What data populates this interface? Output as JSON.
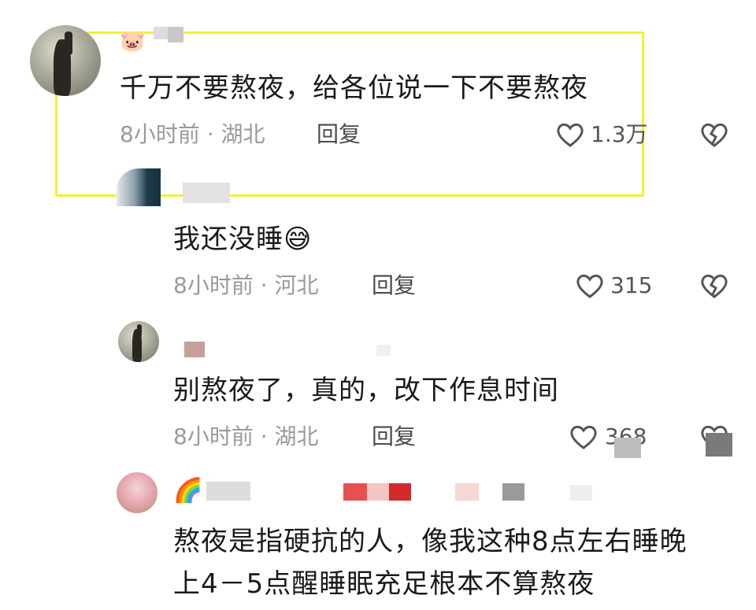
{
  "comments": [
    {
      "text": "千万不要熬夜，给各位说一下不要熬夜",
      "meta": "8小时前 · 湖北",
      "reply": "回复",
      "likes": "1.3万"
    },
    {
      "text": "我还没睡",
      "emoji": "😅",
      "meta": "8小时前 · 河北",
      "reply": "回复",
      "likes": "315"
    },
    {
      "text": "别熬夜了，真的，改下作息时间",
      "meta": "8小时前 · 湖北",
      "reply": "回复",
      "likes": "368"
    },
    {
      "text_line1": "熬夜是指硬抗的人，像我这种8点左右睡晚",
      "text_line2": "上4－5点醒睡眠充足根本不算熬夜",
      "emoji": "🌈"
    }
  ],
  "colors": {
    "highlight": "#f2f230",
    "meta": "#9a9a9a",
    "text": "#1a1a1a"
  }
}
